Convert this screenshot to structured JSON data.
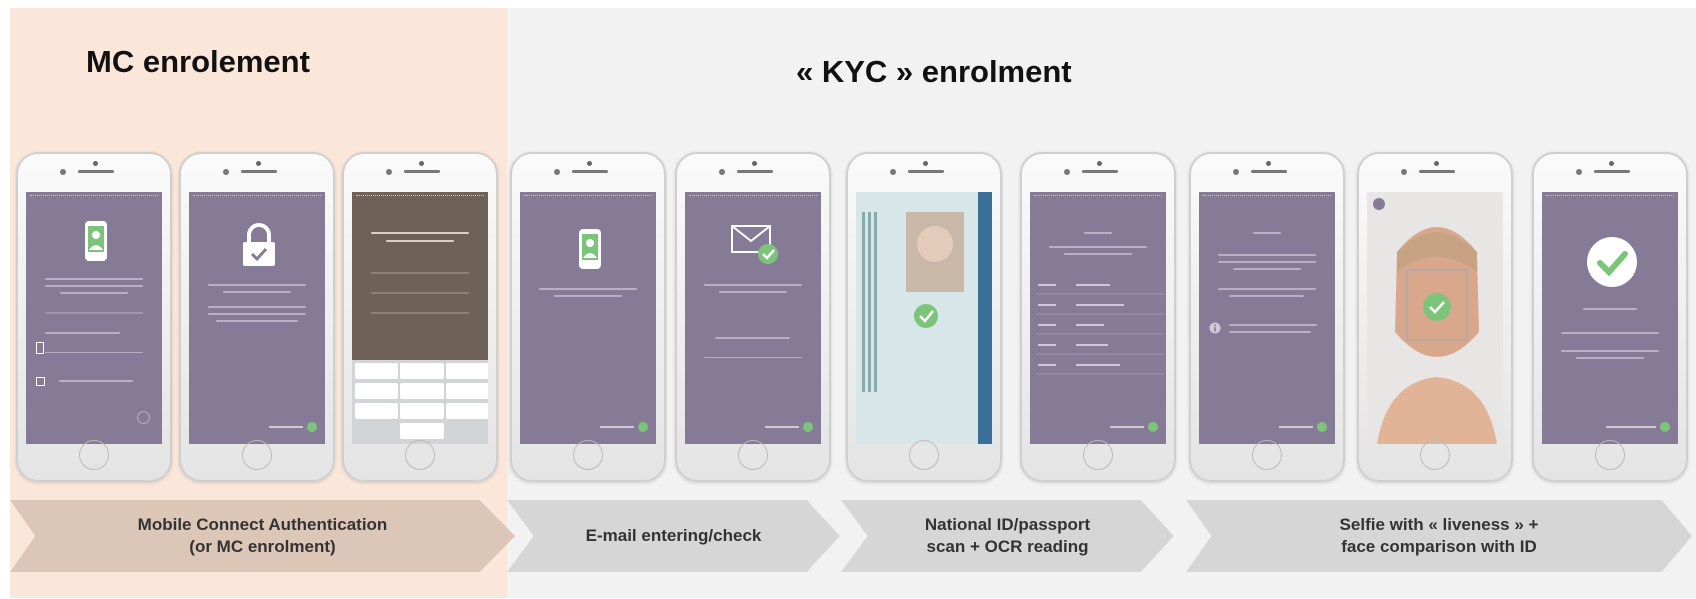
{
  "sections": {
    "mc_title": "MC enrolement",
    "kyc_title": "« KYC » enrolment"
  },
  "steps": [
    {
      "line1": "Mobile Connect Authentication",
      "line2": "(or MC enrolment)"
    },
    {
      "line1": "E-mail entering/check",
      "line2": ""
    },
    {
      "line1": "National ID/passport",
      "line2": "scan + OCR reading"
    },
    {
      "line1": "Selfie with « liveness » +",
      "line2": "face comparison with ID"
    }
  ],
  "phones": [
    {
      "screen": "mc-phone-login",
      "icon": "phone-user-icon"
    },
    {
      "screen": "mc-lock",
      "icon": "lock-icon"
    },
    {
      "screen": "mc-authorization-keypad",
      "icon": "keypad-icon"
    },
    {
      "screen": "kyc-start",
      "icon": "phone-user-icon"
    },
    {
      "screen": "kyc-email",
      "icon": "envelope-check-icon"
    },
    {
      "screen": "kyc-id-scan",
      "icon": "id-card-icon"
    },
    {
      "screen": "kyc-ocr-check",
      "icon": "form-icon"
    },
    {
      "screen": "kyc-selfie-info",
      "icon": "info-icon"
    },
    {
      "screen": "kyc-selfie-face",
      "icon": "face-check-icon"
    },
    {
      "screen": "kyc-success",
      "icon": "check-circle-icon"
    }
  ],
  "colors": {
    "mc_section": "#fbe7da",
    "kyc_section": "#f2f2f2",
    "screen": "#857b96",
    "accent_green": "#7cc47a"
  }
}
